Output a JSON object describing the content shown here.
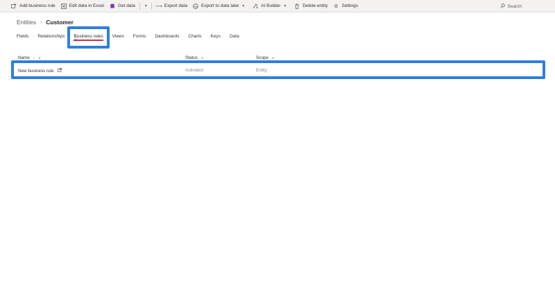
{
  "commandbar": {
    "add_business_rule": "Add business rule",
    "edit_in_excel": "Edit data in Excel",
    "get_data": "Get data",
    "export_data": "Export data",
    "export_data_lake": "Export to data lake",
    "ai_builder": "AI Builder",
    "delete_entity": "Delete entity",
    "settings": "Settings",
    "search": "Search"
  },
  "breadcrumb": {
    "root": "Entities",
    "current": "Customer"
  },
  "tabs": [
    "Fields",
    "Relationships",
    "Business rules",
    "Views",
    "Forms",
    "Dashboards",
    "Charts",
    "Keys",
    "Data"
  ],
  "active_tab": "Business rules",
  "grid": {
    "columns": {
      "name": "Name",
      "name_sort": "↑",
      "status": "Status",
      "scope": "Scope"
    },
    "rows": [
      {
        "name": "New business rule",
        "status": "Activated",
        "scope": "Entity"
      }
    ]
  },
  "colors": {
    "highlight": "#2f7fd9",
    "active_underline": "#c4314b"
  },
  "icons": [
    "add-rule-icon",
    "excel-icon",
    "database-icon",
    "export-arrow-icon",
    "data-lake-icon",
    "ai-builder-icon",
    "trash-icon",
    "gear-icon",
    "search-icon",
    "external-link-icon",
    "mouse-cursor-icon"
  ]
}
